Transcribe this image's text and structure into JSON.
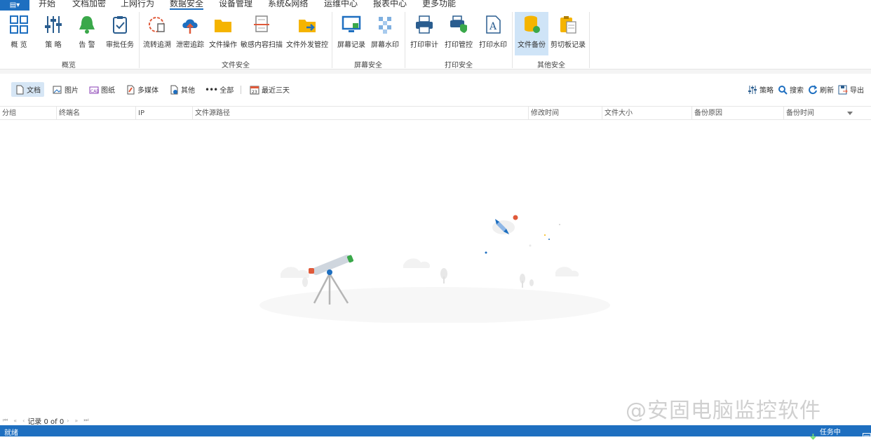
{
  "menubar": {
    "app_icon": "document-menu-icon",
    "tabs": [
      "开始",
      "文档加密",
      "上网行为",
      "数据安全",
      "设备管理",
      "系统&网络",
      "运维中心",
      "报表中心",
      "更多功能"
    ],
    "active_tab": "数据安全"
  },
  "ribbon": {
    "buttons": [
      "概 览",
      "策 略",
      "告 警",
      "审批任务",
      "流转追溯",
      "泄密追踪",
      "文件操作",
      "敏感内容扫描",
      "文件外发管控",
      "屏幕记录",
      "屏幕水印",
      "打印审计",
      "打印管控",
      "打印水印",
      "文件备份",
      "剪切板记录"
    ],
    "active_button": "文件备份",
    "groups": [
      "概览",
      "文件安全",
      "屏幕安全",
      "打印安全",
      "其他安全"
    ]
  },
  "toolbar": {
    "filters": [
      "文档",
      "图片",
      "图纸",
      "多媒体",
      "其他",
      "全部"
    ],
    "active_filter": "文档",
    "date_range": "最近三天",
    "actions": [
      "策略",
      "搜索",
      "刷新",
      "导出"
    ]
  },
  "table": {
    "columns": [
      "分组",
      "终端名",
      "IP",
      "文件源路径",
      "修改时间",
      "文件大小",
      "备份原因",
      "备份时间"
    ],
    "rows": []
  },
  "pager": {
    "record_text": "记录 0 of 0"
  },
  "watermark": "@安固电脑监控软件",
  "status": {
    "left": "就绪",
    "task_center": "任务中心"
  },
  "colors": {
    "accent": "#1e6fc0",
    "active_bg": "#cfe4f7",
    "status_bar": "#1e6fc0"
  }
}
